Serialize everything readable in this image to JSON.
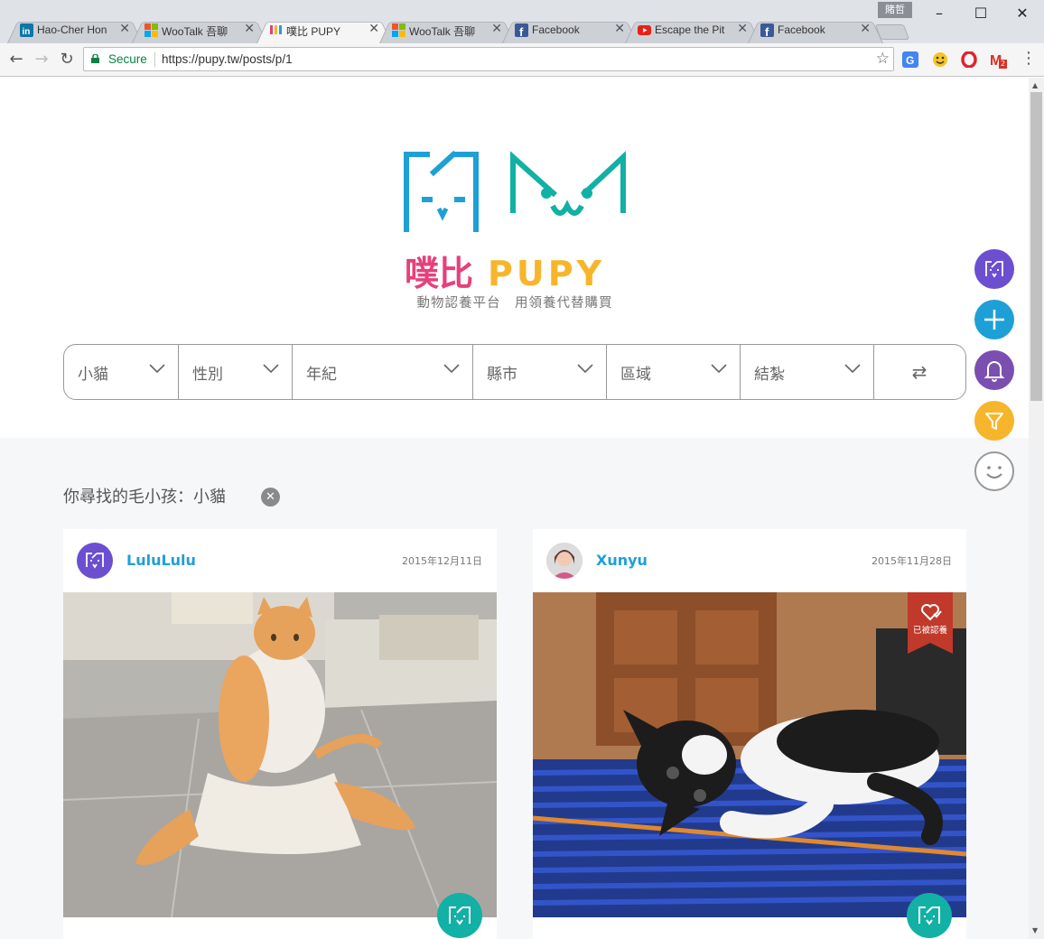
{
  "browser": {
    "profile": "賭哲",
    "tabs": [
      {
        "title": "Hao-Cher Hon",
        "icon": "linkedin-icon"
      },
      {
        "title": "WooTalk 吾聊",
        "icon": "windows-icon"
      },
      {
        "title": "噗比 PUPY",
        "icon": "pupy-icon"
      },
      {
        "title": "WooTalk 吾聊",
        "icon": "windows-icon"
      },
      {
        "title": "Facebook",
        "icon": "facebook-icon"
      },
      {
        "title": "Escape the Pit",
        "icon": "youtube-icon"
      },
      {
        "title": "Facebook",
        "icon": "facebook-icon"
      }
    ],
    "secure_label": "Secure",
    "url": "https://pupy.tw/posts/p/1",
    "gmail_count": "2"
  },
  "site": {
    "name_cn": "噗比",
    "name_en": "PUPY",
    "tagline": "動物認養平台　用領養代替購買"
  },
  "filters": {
    "species": "小貓",
    "gender": "性別",
    "age": "年紀",
    "city": "縣市",
    "district": "區域",
    "neuter": "結紮"
  },
  "results": {
    "label": "你尋找的毛小孩：小貓"
  },
  "posts": [
    {
      "user": "LuluLulu",
      "date": "2015年12月11日",
      "adopted": false
    },
    {
      "user": "Xunyu",
      "date": "2015年11月28日",
      "adopted": true,
      "adopted_label": "已被認養"
    }
  ],
  "colors": {
    "teal": "#13b0a5",
    "blue": "#1ea0d7",
    "purple": "#6c4fd0",
    "violet": "#7a4fb0",
    "yellow": "#f7b52c"
  }
}
